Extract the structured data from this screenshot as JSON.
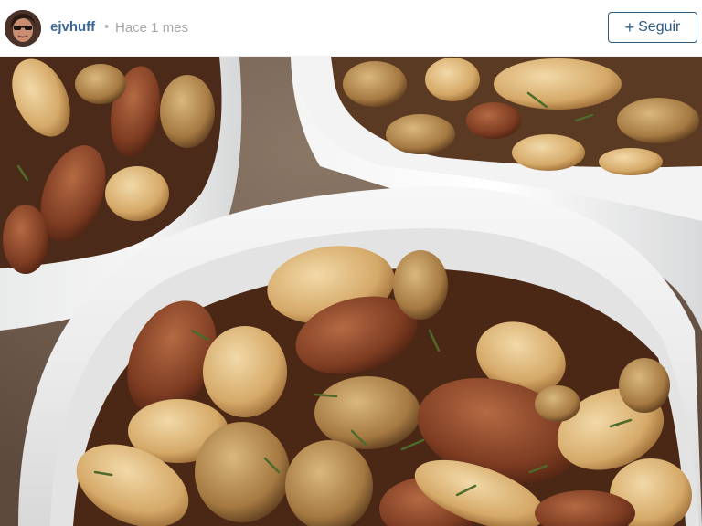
{
  "post": {
    "username": "ejvhuff",
    "separator": "•",
    "timestamp": "Hace 1 mes",
    "follow_label": "Seguir",
    "follow_icon": "plus-icon"
  },
  "photo": {
    "subject": "bowls-of-roasted-mixed-nuts"
  },
  "colors": {
    "username": "#3b6997",
    "timestamp": "#a5a7aa",
    "follow_border": "#2e5b83"
  }
}
